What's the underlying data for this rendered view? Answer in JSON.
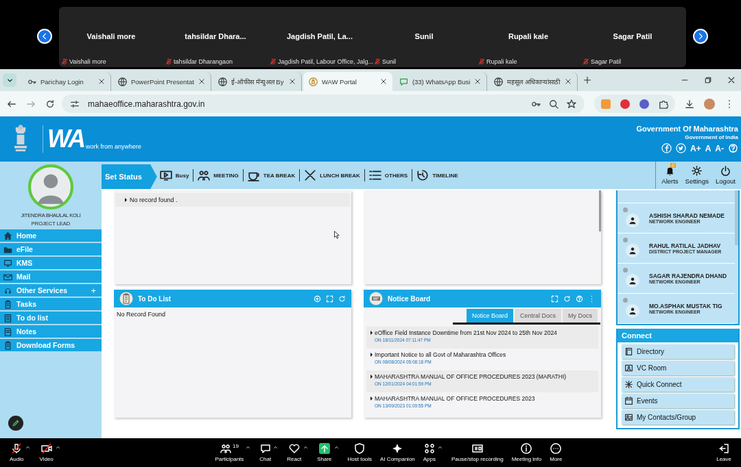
{
  "meeting": {
    "participants": [
      {
        "name": "Vaishali more",
        "label": "Vaishali more",
        "muted": true
      },
      {
        "name": "tahsildar Dhara...",
        "label": "tahsildar Dharangaon",
        "muted": true
      },
      {
        "name": "Jagdish Patil, La...",
        "label": "Jagdish Patil, Labour Office, Jalg...",
        "muted": true
      },
      {
        "name": "Sunil",
        "label": "Sunil",
        "muted": true
      },
      {
        "name": "Rupali kale",
        "label": "Rupali kale",
        "muted": true
      },
      {
        "name": "Sagar Patil",
        "label": "Sagar Patil",
        "muted": true
      }
    ]
  },
  "browser": {
    "tabs": [
      {
        "title": "Parichay Login",
        "selected": false
      },
      {
        "title": "PowerPoint Presentat",
        "selected": false
      },
      {
        "title": "ई-ऑफीस मॅन्युअल By",
        "selected": false
      },
      {
        "title": "WAW Portal",
        "selected": true
      },
      {
        "title": "(33) WhatsApp Busi",
        "selected": false
      },
      {
        "title": "महसूल अधिकाऱ्यांसाठी",
        "selected": false
      }
    ],
    "url": "mahaeoffice.maharashtra.gov.in"
  },
  "header": {
    "logo": "WA",
    "tagline": "work from anywhere",
    "org": "Government Of Maharashtra",
    "suborg": "Government of India",
    "font_controls": [
      "A+",
      "A",
      "A-"
    ]
  },
  "status_bar": {
    "title": "Set Status",
    "items": [
      {
        "label": "Busy"
      },
      {
        "label": "MEETING"
      },
      {
        "label": "TEA BREAK"
      },
      {
        "label": "LUNCH BREAK"
      },
      {
        "label": "OTHERS"
      },
      {
        "label": "TIMELINE"
      }
    ],
    "actions": [
      {
        "label": "Alerts",
        "badge": "0"
      },
      {
        "label": "Settings"
      },
      {
        "label": "Logout"
      }
    ]
  },
  "profile": {
    "name": "JITENDRA BHAULAL KOLI",
    "role": "PROJECT LEAD"
  },
  "sidebar": {
    "items": [
      {
        "label": "Home"
      },
      {
        "label": "eFile"
      },
      {
        "label": "KMS"
      },
      {
        "label": "Mail"
      },
      {
        "label": "Other Services",
        "toggle": "+"
      },
      {
        "label": "Tasks"
      },
      {
        "label": "To do list"
      },
      {
        "label": "Notes"
      },
      {
        "label": "Download Forms"
      }
    ]
  },
  "top_panel": {
    "rows": [
      "No record found ."
    ]
  },
  "todo": {
    "title": "To Do List",
    "empty": "No Record Found"
  },
  "notice_board": {
    "title": "Notice Board",
    "tabs": [
      {
        "label": "Notice Board",
        "selected": true
      },
      {
        "label": "Central Docs",
        "selected": false
      },
      {
        "label": "My Docs",
        "selected": false
      }
    ],
    "notices": [
      {
        "title": "eOffice Field Instance Downtime from 21st Nov 2024 to 25th Nov 2024",
        "date": "ON 18/11/2024 07:11:47 PM"
      },
      {
        "title": "Important Notice to all Govt of Maharashtra Offices",
        "date": "ON 08/08/2024 05:08:18 PM"
      },
      {
        "title": "MAHARASHTRA MANUAL OF OFFICE PROCEDURES 2023 (MARATHI)",
        "date": "ON 12/01/2024 04:01:59 PM"
      },
      {
        "title": "MAHARASHTRA MANUAL OF OFFICE PROCEDURES 2023",
        "date": "ON 13/09/2023 01:09:55 PM"
      }
    ]
  },
  "contacts": [
    {
      "name": "ASHISH SHARAD NEMADE",
      "role": "NETWORK ENGINEER"
    },
    {
      "name": "RAHUL RATILAL JADHAV",
      "role": "DISTRICT PROJECT MANAGER"
    },
    {
      "name": "SAGAR RAJENDRA DHAND",
      "role": "NETWORK ENGINEER"
    },
    {
      "name": "MO.ASPHAK MUSTAK TIG",
      "role": "NETWORK ENGINEER"
    }
  ],
  "connect": {
    "title": "Connect",
    "items": [
      {
        "label": "Directory"
      },
      {
        "label": "VC Room"
      },
      {
        "label": "Quick Connect"
      },
      {
        "label": "Events"
      },
      {
        "label": "My Contacts/Group"
      }
    ]
  },
  "toolbar": {
    "items": [
      {
        "label": "Audio",
        "muted": true,
        "menu": true
      },
      {
        "label": "Video",
        "muted": true,
        "menu": true
      },
      {
        "label": "Participants",
        "count": "19",
        "menu": true
      },
      {
        "label": "Chat",
        "menu": true
      },
      {
        "label": "React",
        "menu": true
      },
      {
        "label": "Share",
        "menu": true
      },
      {
        "label": "Host tools",
        "menu": false
      },
      {
        "label": "AI Companion",
        "menu": false
      },
      {
        "label": "Apps",
        "menu": true
      },
      {
        "label": "Pause/stop recording",
        "menu": false
      },
      {
        "label": "Meeting info",
        "menu": false
      },
      {
        "label": "More",
        "menu": false
      },
      {
        "label": "Leave",
        "menu": false
      }
    ]
  }
}
